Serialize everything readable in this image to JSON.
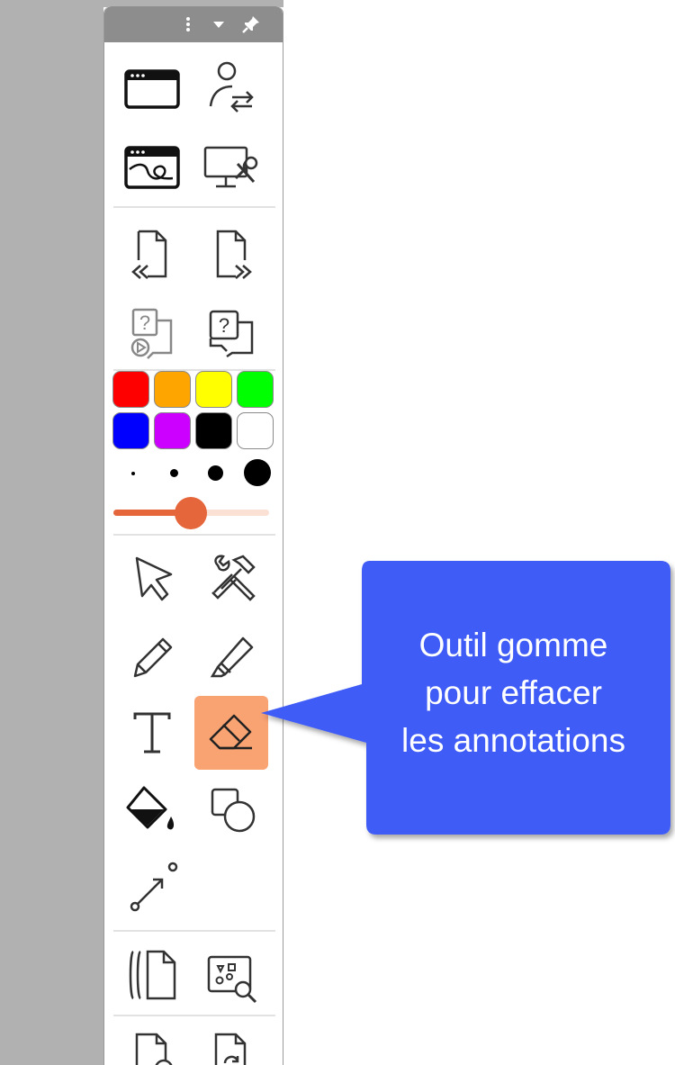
{
  "titlebar": {
    "menu_icon": "vertical-ellipsis-icon",
    "collapse_icon": "caret-down-icon",
    "pin_icon": "pin-icon"
  },
  "tools": [
    {
      "id": "window",
      "icon": "window-icon"
    },
    {
      "id": "user-switch",
      "icon": "user-switch-icon"
    },
    {
      "id": "window-drawing",
      "icon": "window-drawing-icon"
    },
    {
      "id": "monitor-settings",
      "icon": "monitor-wrench-icon"
    },
    {
      "id": "previous-page",
      "icon": "page-previous-icon"
    },
    {
      "id": "next-page",
      "icon": "page-next-icon"
    },
    {
      "id": "video-help",
      "icon": "video-help-icon"
    },
    {
      "id": "help",
      "icon": "help-chat-icon"
    },
    {
      "id": "select",
      "icon": "cursor-arrow-icon"
    },
    {
      "id": "tools",
      "icon": "wrench-hammer-icon"
    },
    {
      "id": "pencil",
      "icon": "pencil-icon"
    },
    {
      "id": "highlighter",
      "icon": "highlighter-icon"
    },
    {
      "id": "text",
      "icon": "text-icon"
    },
    {
      "id": "eraser",
      "icon": "eraser-icon",
      "active": true
    },
    {
      "id": "fill",
      "icon": "paint-bucket-icon"
    },
    {
      "id": "shapes",
      "icon": "shapes-icon"
    },
    {
      "id": "line",
      "icon": "line-arrow-icon"
    },
    {
      "id": "pages",
      "icon": "pages-icon"
    },
    {
      "id": "image-search",
      "icon": "image-search-icon"
    },
    {
      "id": "page-search",
      "icon": "page-search-icon"
    },
    {
      "id": "page-refresh",
      "icon": "page-refresh-icon"
    }
  ],
  "colors": [
    "#ff0000",
    "#ffa500",
    "#ffff00",
    "#00ff00",
    "#0000ff",
    "#cc00ff",
    "#000000",
    "#ffffff"
  ],
  "brush_sizes": [
    "extra-small",
    "small",
    "medium",
    "large"
  ],
  "slider": {
    "value": 0.5
  },
  "accent_color": "#f9a272",
  "callout": {
    "line1": "Outil gomme",
    "line2": "pour effacer",
    "line3": "les annotations",
    "color": "#3f5cf6"
  }
}
